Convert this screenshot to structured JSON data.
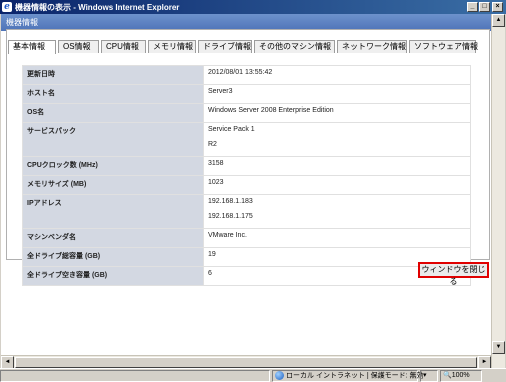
{
  "window": {
    "title": "機器情報の表示 - Windows Internet Explorer",
    "min": "_",
    "max": "□",
    "close": "×"
  },
  "page": {
    "header": "機器情報"
  },
  "tabs": [
    {
      "label": "基本情報",
      "active": true
    },
    {
      "label": "OS情報"
    },
    {
      "label": "CPU情報"
    },
    {
      "label": "メモリ情報"
    },
    {
      "label": "ドライブ情報"
    },
    {
      "label": "その他のマシン情報"
    },
    {
      "label": "ネットワーク情報"
    },
    {
      "label": "ソフトウェア情報"
    }
  ],
  "rows": [
    {
      "label": "更新日時",
      "values": [
        "2012/08/01 13:55:42"
      ]
    },
    {
      "label": "ホスト名",
      "values": [
        "Server3"
      ]
    },
    {
      "label": "OS名",
      "values": [
        "Windows Server 2008 Enterprise Edition"
      ]
    },
    {
      "label": "サービスパック",
      "values": [
        "Service Pack 1",
        "R2"
      ]
    },
    {
      "label": "CPUクロック数 (MHz)",
      "values": [
        "3158"
      ]
    },
    {
      "label": "メモリサイズ (MB)",
      "values": [
        "1023"
      ]
    },
    {
      "label": "IPアドレス",
      "values": [
        "192.168.1.183",
        "192.168.1.175"
      ]
    },
    {
      "label": "マシンベンダ名",
      "values": [
        "VMware Inc."
      ]
    },
    {
      "label": "全ドライブ総容量 (GB)",
      "values": [
        "19"
      ]
    },
    {
      "label": "全ドライブ空き容量 (GB)",
      "values": [
        "6"
      ]
    }
  ],
  "close_button": "ウィンドウを閉じる",
  "statusbar": {
    "zone": "ローカル イントラネット | 保護モード: 無効",
    "zoom": "100%"
  },
  "scroll": {
    "up": "▲",
    "down": "▼",
    "left": "◄",
    "right": "►"
  }
}
